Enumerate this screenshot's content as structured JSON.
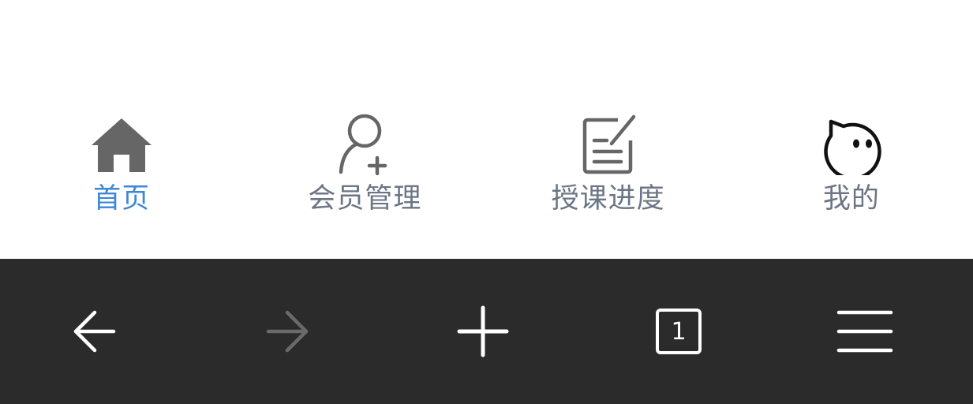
{
  "tab_bar": {
    "tabs": [
      {
        "label": "首页",
        "icon": "home-icon",
        "active": true
      },
      {
        "label": "会员管理",
        "icon": "add-member-icon",
        "active": false
      },
      {
        "label": "授课进度",
        "icon": "edit-note-icon",
        "active": false
      },
      {
        "label": "我的",
        "icon": "profile-face-icon",
        "active": false
      }
    ],
    "colors": {
      "active_label": "#3d87d6",
      "inactive_label": "#6b7585",
      "home_icon": "#666666",
      "inactive_icon": "#666666",
      "profile_icon": "#111111"
    }
  },
  "browser_bar": {
    "background": "#2b2b2b",
    "buttons": [
      {
        "name": "back",
        "icon": "arrow-left-icon",
        "enabled": true
      },
      {
        "name": "forward",
        "icon": "arrow-right-icon",
        "enabled": false
      },
      {
        "name": "new-tab",
        "icon": "plus-icon",
        "enabled": true
      },
      {
        "name": "tabs",
        "icon": "tab-count-icon",
        "enabled": true
      },
      {
        "name": "menu",
        "icon": "hamburger-menu-icon",
        "enabled": true
      }
    ],
    "tab_count": "1"
  }
}
